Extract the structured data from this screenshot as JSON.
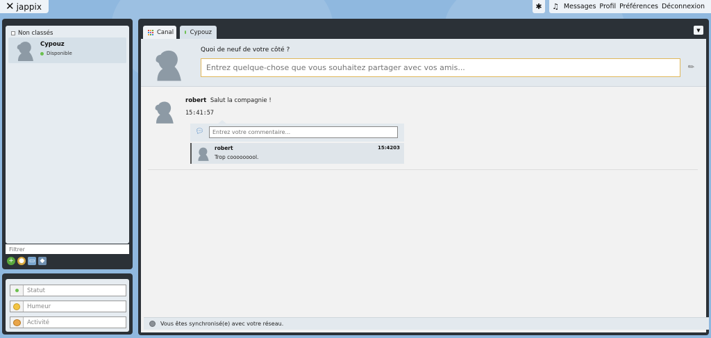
{
  "app": {
    "logo_text": "jappix"
  },
  "topbar": {
    "icons": [
      {
        "name": "asterisk-icon",
        "glyph": "✱"
      },
      {
        "name": "music-note-icon",
        "glyph": "♫"
      }
    ],
    "menu": [
      "Messages",
      "Profil",
      "Préférences",
      "Déconnexion"
    ]
  },
  "roster": {
    "group_label": "Non classés",
    "buddy": {
      "name": "Cypouz",
      "status": "Disponible"
    },
    "filter_placeholder": "Filtrer"
  },
  "presence": {
    "status_placeholder": "Statut",
    "mood_placeholder": "Humeur",
    "activity_placeholder": "Activité"
  },
  "tabs": [
    {
      "label": "Canal"
    },
    {
      "label": "Cypouz"
    }
  ],
  "share": {
    "title": "Quoi de neuf de votre côté ?",
    "placeholder": "Entrez quelque-chose que vous souhaitez partager avec vos amis..."
  },
  "post": {
    "author": "robert",
    "text": "Salut la compagnie !",
    "time": "15:41:57",
    "comment_placeholder": "Entrez votre commentaire...",
    "reply": {
      "author": "robert",
      "time": "15:4203",
      "text": "Trop cooooooool."
    }
  },
  "footer": {
    "sync_text": "Vous êtes synchronisé(e) avec votre réseau."
  },
  "colors": {
    "accent": "#8fb8df",
    "panel_dark": "#2b3137",
    "online": "#6bbf4e",
    "input_focus": "#e0b75a"
  }
}
